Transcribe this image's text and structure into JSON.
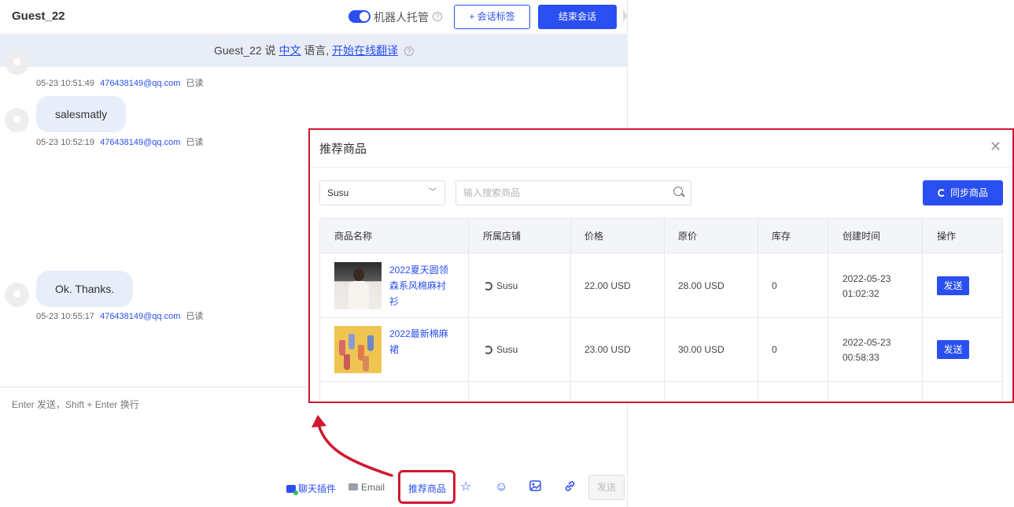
{
  "header": {
    "guest_name": "Guest_22",
    "robot_label": "机器人托管",
    "robot_enabled": true,
    "tag_button": "+ 会话标签",
    "end_button": "结束会话"
  },
  "translate_bar": {
    "prefix": "Guest_22 说 ",
    "language_link": "中文",
    "middle": " 语言, ",
    "action_link": "开始在线翻译"
  },
  "messages": [
    {
      "text": "",
      "time": "05-23 10:51:49",
      "email": "476438149@qq.com",
      "status": "已读"
    },
    {
      "text": "salesmatly",
      "time": "05-23 10:52:19",
      "email": "476438149@qq.com",
      "status": "已读"
    },
    {
      "text": "Ok. Thanks.",
      "time": "05-23 10:55:17",
      "email": "476438149@qq.com",
      "status": "已读"
    }
  ],
  "input": {
    "placeholder": "Enter 发送，Shift + Enter 换行"
  },
  "toolbar": {
    "plugin_label": "聊天插件",
    "email_label": "Email",
    "recommend_label": "推荐商品",
    "send_label": "发送",
    "icons": [
      "star-icon",
      "emoji-icon",
      "image-icon",
      "link-icon"
    ]
  },
  "modal": {
    "title": "推荐商品",
    "store_selected": "Susu",
    "search_placeholder": "输入搜索商品",
    "sync_button": "同步商品",
    "columns": [
      "商品名称",
      "所属店铺",
      "价格",
      "原价",
      "库存",
      "创建时间",
      "操作"
    ],
    "rows": [
      {
        "name": "2022夏天圆领森系风棉麻衬衫",
        "name_lines": [
          "2022夏天圆领",
          "森系风棉麻衬",
          "衫"
        ],
        "shop": "Susu",
        "price": "22.00 USD",
        "original_price": "28.00 USD",
        "stock": "0",
        "created_date": "2022-05-23",
        "created_time": "01:02:32",
        "action": "发送"
      },
      {
        "name": "2022最新棉麻裙",
        "name_lines": [
          "2022最新棉麻",
          "裙"
        ],
        "shop": "Susu",
        "price": "23.00 USD",
        "original_price": "30.00 USD",
        "stock": "0",
        "created_date": "2022-05-23",
        "created_time": "00:58:33",
        "action": "发送"
      }
    ]
  },
  "colors": {
    "primary": "#2a4ff0",
    "highlight": "#d0182f",
    "bubble": "#e7edf9",
    "translate_bar": "#e8edf7"
  }
}
